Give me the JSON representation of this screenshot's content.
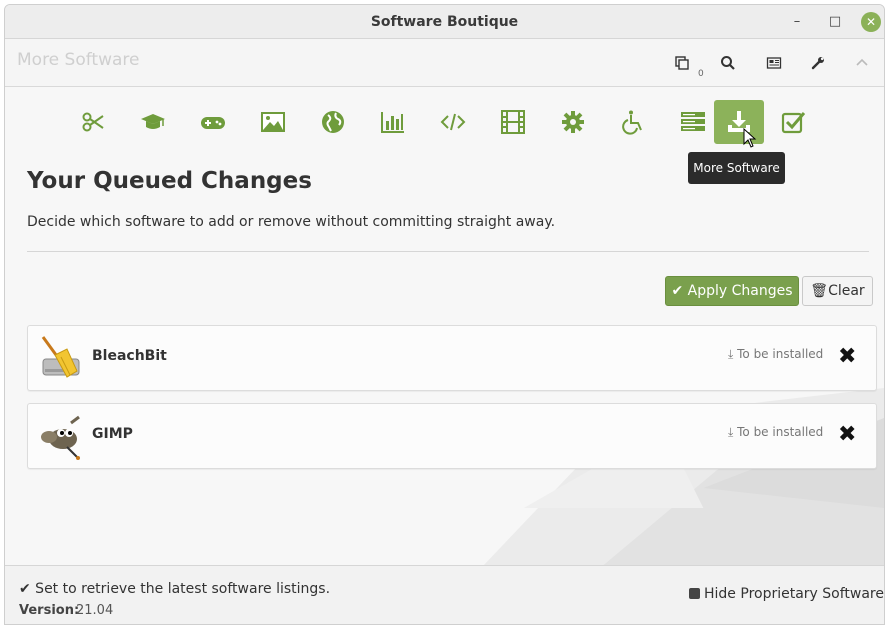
{
  "window": {
    "title": "Software Boutique",
    "minimize": "–",
    "maximize": "□",
    "close": "✕"
  },
  "header": {
    "page_title": "More Software",
    "queue_count": "0",
    "icons": [
      "copy-icon",
      "search-icon",
      "news-icon",
      "wrench-icon",
      "chevron-up-icon"
    ]
  },
  "categories": [
    {
      "name": "accessories",
      "icon": "scissors-icon"
    },
    {
      "name": "education",
      "icon": "graduation-cap-icon"
    },
    {
      "name": "games",
      "icon": "gamepad-icon"
    },
    {
      "name": "graphics",
      "icon": "image-icon"
    },
    {
      "name": "internet",
      "icon": "globe-icon"
    },
    {
      "name": "office",
      "icon": "chart-icon"
    },
    {
      "name": "programming",
      "icon": "code-icon"
    },
    {
      "name": "media",
      "icon": "film-icon"
    },
    {
      "name": "system",
      "icon": "gear-icon"
    },
    {
      "name": "accessibility",
      "icon": "wheelchair-icon"
    },
    {
      "name": "servers",
      "icon": "server-icon"
    },
    {
      "name": "more-software",
      "icon": "download-icon",
      "active": true
    },
    {
      "name": "installed",
      "icon": "checkbox-icon"
    }
  ],
  "tooltip": "More Software",
  "main": {
    "heading": "Your Queued Changes",
    "description": "Decide which software to add or remove without committing straight away.",
    "apply_label": "✔ Apply Changes",
    "clear_label": "🗑Clear"
  },
  "queue": [
    {
      "name": "BleachBit",
      "status": "⤓ To be installed",
      "icon": "bleachbit-icon"
    },
    {
      "name": "GIMP",
      "status": "⤓ To be installed",
      "icon": "gimp-icon"
    }
  ],
  "footer": {
    "message": "✔ Set to retrieve the latest software listings.",
    "version_label": "Version:",
    "version_value": "21.04",
    "hide_proprietary": "Hide Proprietary Software"
  },
  "colors": {
    "accent": "#8cb25a",
    "apply_button": "#7aa04d",
    "tooltip_bg": "#2b2b2b"
  }
}
